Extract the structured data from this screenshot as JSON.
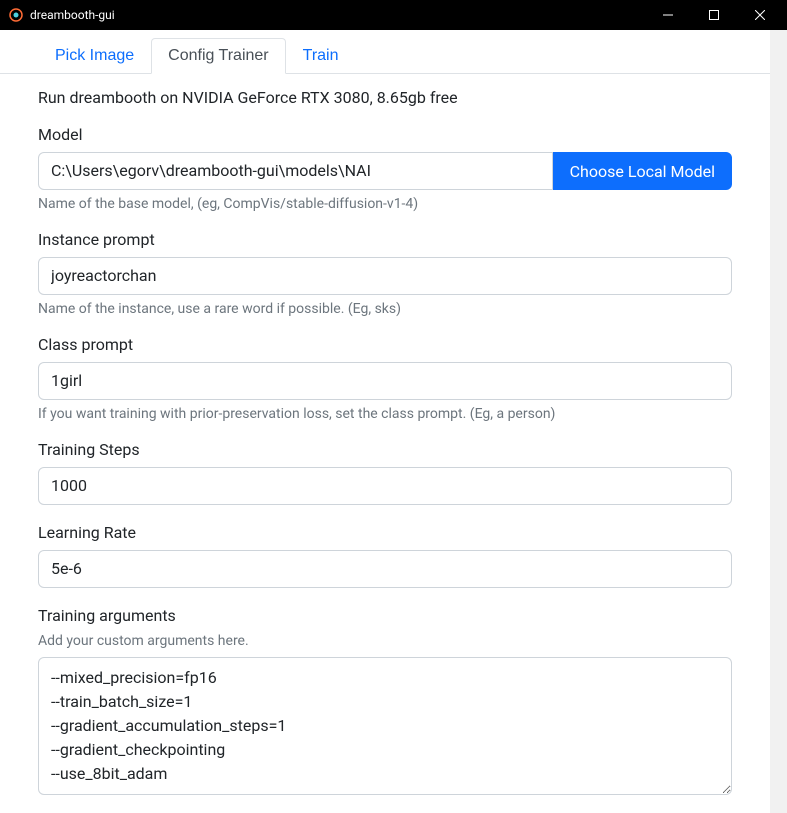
{
  "window": {
    "title": "dreambooth-gui"
  },
  "tabs": {
    "pick_image": "Pick Image",
    "config_trainer": "Config Trainer",
    "train": "Train"
  },
  "status_text": "Run dreambooth on NVIDIA GeForce RTX 3080, 8.65gb free",
  "model": {
    "label": "Model",
    "value": "C:\\Users\\egorv\\dreambooth-gui\\models\\NAI",
    "button": "Choose Local Model",
    "help": "Name of the base model, (eg, CompVis/stable-diffusion-v1-4)"
  },
  "instance_prompt": {
    "label": "Instance prompt",
    "value": "joyreactorchan",
    "help": "Name of the instance, use a rare word if possible. (Eg, sks)"
  },
  "class_prompt": {
    "label": "Class prompt",
    "value": "1girl",
    "help": "If you want training with prior-preservation loss, set the class prompt. (Eg, a person)"
  },
  "training_steps": {
    "label": "Training Steps",
    "value": "1000"
  },
  "learning_rate": {
    "label": "Learning Rate",
    "value": "5e-6"
  },
  "training_arguments": {
    "label": "Training arguments",
    "description": "Add your custom arguments here.",
    "value": "--mixed_precision=fp16\n--train_batch_size=1\n--gradient_accumulation_steps=1\n--gradient_checkpointing\n--use_8bit_adam"
  }
}
